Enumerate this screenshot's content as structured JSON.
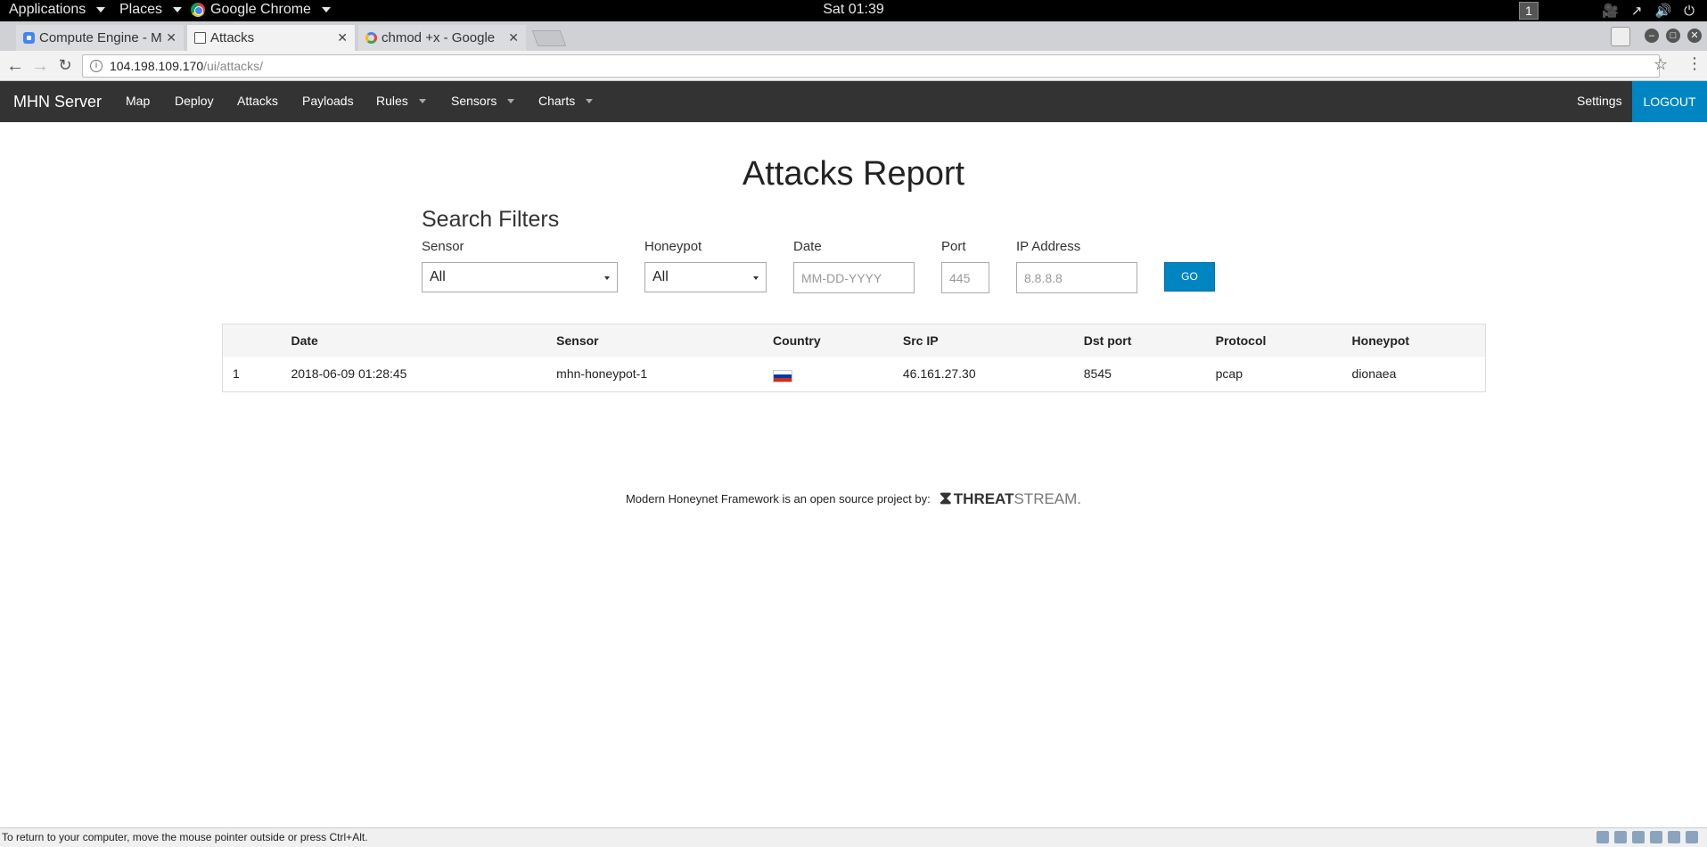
{
  "topbar": {
    "applications": "Applications",
    "places": "Places",
    "chrome_app": "Google Chrome",
    "clock": "Sat 01:39",
    "workspace": "1"
  },
  "tabs": [
    {
      "label": "Compute Engine - M",
      "favicon": "compute-engine-icon"
    },
    {
      "label": "Attacks",
      "favicon": "document-icon"
    },
    {
      "label": "chmod +x - Google",
      "favicon": "google-icon"
    }
  ],
  "omnibox": {
    "host": "104.198.109.170",
    "path": "/ui/attacks/"
  },
  "navbar": {
    "brand": "MHN Server",
    "links": [
      "Map",
      "Deploy",
      "Attacks",
      "Payloads",
      "Rules",
      "Sensors",
      "Charts"
    ],
    "settings": "Settings",
    "logout": "LOGOUT"
  },
  "page": {
    "title": "Attacks Report",
    "filters_heading": "Search Filters"
  },
  "filters": {
    "sensor_label": "Sensor",
    "sensor_value": "All",
    "honeypot_label": "Honeypot",
    "honeypot_value": "All",
    "date_label": "Date",
    "date_placeholder": "MM-DD-YYYY",
    "port_label": "Port",
    "port_placeholder": "445",
    "ip_label": "IP Address",
    "ip_placeholder": "8.8.8.8",
    "go": "GO"
  },
  "table": {
    "headers": [
      "",
      "Date",
      "Sensor",
      "Country",
      "Src IP",
      "Dst port",
      "Protocol",
      "Honeypot"
    ],
    "rows": [
      {
        "index": "1",
        "date": "2018-06-09 01:28:45",
        "sensor": "mhn-honeypot-1",
        "country_flag": "russia-flag",
        "src_ip": "46.161.27.30",
        "dst_port": "8545",
        "protocol": "pcap",
        "honeypot": "dionaea"
      }
    ]
  },
  "footer": {
    "text": "Modern Honeynet Framework is an open source project by:",
    "logo_strong": "THREAT",
    "logo_light": "STREAM."
  },
  "vm_status": {
    "text": "To return to your computer, move the mouse pointer outside or press Ctrl+Alt."
  },
  "colors": {
    "navbar_bg": "#333333",
    "accent": "#0085c3"
  }
}
